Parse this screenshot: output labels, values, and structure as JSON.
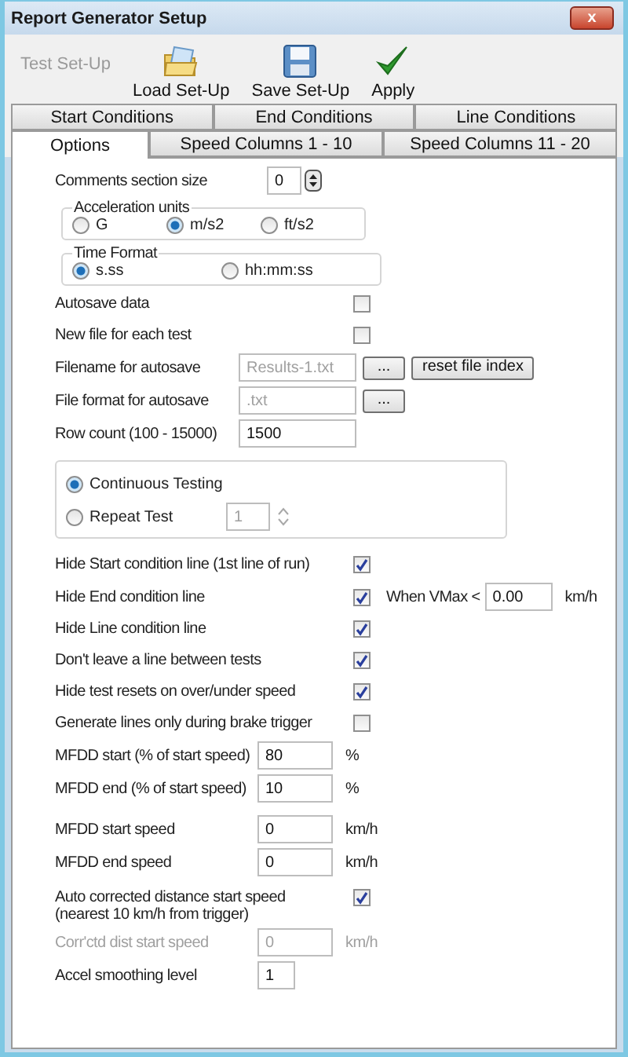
{
  "window": {
    "title": "Report Generator Setup",
    "close": "x"
  },
  "toolbar": [
    {
      "kind": "text",
      "label": "Test Set-Up",
      "disabled": true
    },
    {
      "kind": "open",
      "label": "Load Set-Up",
      "disabled": false
    },
    {
      "kind": "save",
      "label": "Save Set-Up",
      "disabled": false
    },
    {
      "kind": "apply",
      "label": "Apply",
      "disabled": false
    }
  ],
  "tab_rows": [
    [
      {
        "label": "Start Conditions",
        "selected": false
      },
      {
        "label": "End Conditions",
        "selected": false
      },
      {
        "label": "Line Conditions",
        "selected": false
      }
    ],
    [
      {
        "label": "Options",
        "selected": true
      },
      {
        "label": "Speed Columns 1 - 10",
        "selected": false
      },
      {
        "label": "Speed Columns 11 - 20",
        "selected": false
      }
    ]
  ],
  "sections": [
    [
      {
        "kind": "spinner",
        "label": "Comments section size",
        "value": "0"
      },
      {
        "kind": "radio_group",
        "title": "Acceleration units",
        "options": [
          {
            "label": "G",
            "selected": false
          },
          {
            "label": "m/s2",
            "selected": true
          },
          {
            "label": "ft/s2",
            "selected": false
          }
        ]
      },
      {
        "kind": "radio_group",
        "title": "Time Format",
        "options": [
          {
            "label": "s.ss",
            "selected": true
          },
          {
            "label": "hh:mm:ss",
            "selected": false
          }
        ]
      },
      {
        "kind": "checkbox",
        "label": "Autosave data",
        "checked": false
      },
      {
        "kind": "checkbox",
        "label": "New file for each test",
        "checked": false
      },
      {
        "kind": "path_field",
        "label": "Filename for autosave",
        "value": "Results-1.txt",
        "disabled": true,
        "buttons": [
          "...",
          "reset file index"
        ]
      },
      {
        "kind": "path_field",
        "label": "File format for autosave",
        "value": ".txt",
        "disabled": true,
        "buttons": [
          "..."
        ]
      },
      {
        "kind": "path_field",
        "label": "Row count (100 - 15000)",
        "value": "1500",
        "disabled": false
      }
    ],
    [
      {
        "kind": "run_mode",
        "options": [
          {
            "label": "Continuous Testing",
            "selected": true
          },
          {
            "label": "Repeat Test",
            "selected": false,
            "count": "1"
          }
        ]
      }
    ],
    [
      {
        "kind": "checkbox",
        "label": "Hide Start condition line (1st line of run)",
        "checked": true
      },
      {
        "kind": "checkbox",
        "label": "Hide End condition line",
        "checked": true,
        "threshold": {
          "label": "When VMax <",
          "value": "0.00",
          "unit": "km/h"
        }
      },
      {
        "kind": "checkbox",
        "label": "Hide Line condition line",
        "checked": true
      },
      {
        "kind": "checkbox",
        "label": "Don't leave a line between tests",
        "checked": true
      },
      {
        "kind": "checkbox",
        "label": "Hide test resets on over/under speed",
        "checked": true
      },
      {
        "kind": "checkbox",
        "label": "Generate lines only during brake trigger",
        "checked": false
      },
      {
        "kind": "number_field",
        "label": "MFDD start (% of start speed)",
        "value": "80",
        "unit": "%",
        "disabled": false
      },
      {
        "kind": "number_field",
        "label": "MFDD end (% of start speed)",
        "value": "10",
        "unit": "%",
        "disabled": false
      }
    ],
    [
      {
        "kind": "number_field",
        "label": "MFDD start speed",
        "value": "0",
        "unit": "km/h",
        "disabled": false
      },
      {
        "kind": "number_field",
        "label": "MFDD end speed",
        "value": "0",
        "unit": "km/h",
        "disabled": false
      }
    ],
    [
      {
        "kind": "checkbox",
        "label": "Auto corrected distance start speed",
        "note": "(nearest 10 km/h from trigger)",
        "checked": true
      },
      {
        "kind": "number_field",
        "label": "Corr'ctd dist start speed",
        "value": "0",
        "unit": "km/h",
        "disabled": true
      },
      {
        "kind": "number_field",
        "label": "Accel smoothing level",
        "value": "1",
        "disabled": false
      }
    ]
  ]
}
